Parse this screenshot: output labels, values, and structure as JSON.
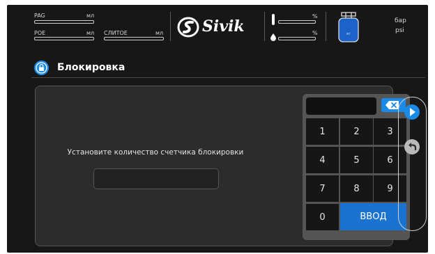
{
  "header": {
    "pag_label": "PAG",
    "pag_unit": "мл",
    "poe_label": "POE",
    "poe_unit": "мл",
    "drain_label": "СЛИТОЕ",
    "drain_unit": "мл",
    "brand": "Sivik",
    "percent_sign_1": "%",
    "percent_sign_2": "%",
    "tank_unit": "кг",
    "pressure_unit_1": "бар",
    "pressure_unit_2": "psi"
  },
  "page": {
    "title": "Блокировка"
  },
  "form": {
    "prompt": "Установите количество счетчика блокировки",
    "count_value": ""
  },
  "keypad": {
    "display_value": "",
    "keys": [
      "1",
      "2",
      "3",
      "4",
      "5",
      "6",
      "7",
      "8",
      "9",
      "0"
    ],
    "enter_label": "ВВОД"
  },
  "colors": {
    "screen_bg": "#171717",
    "panel_bg": "#2c2c2c",
    "accent_blue": "#1b8ae6"
  },
  "icons": {
    "lock": "lock-icon",
    "backspace": "backspace-icon",
    "next": "play-icon",
    "back": "back-arrow-icon",
    "oil": "oil-drop-icon",
    "tank": "refrigerant-tank-icon"
  }
}
